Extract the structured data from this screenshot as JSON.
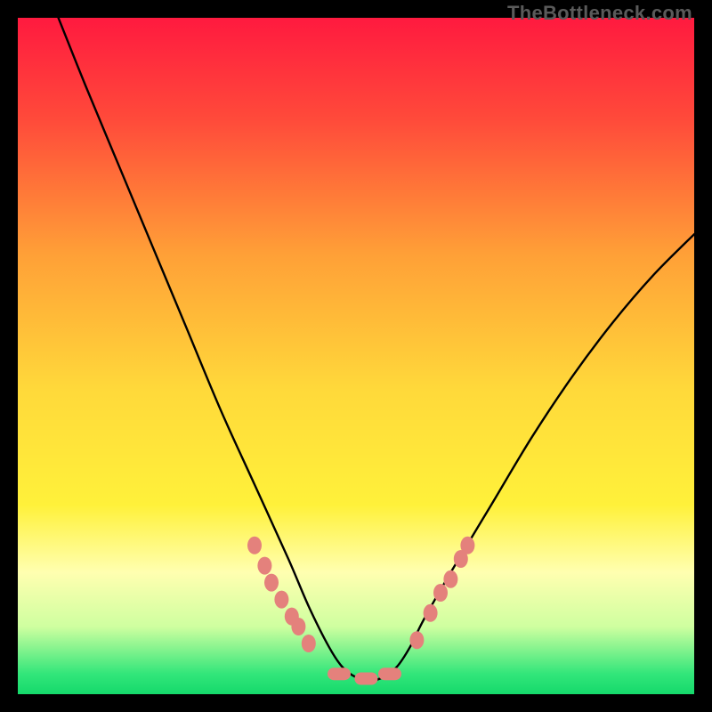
{
  "watermark": "TheBottleneck.com",
  "chart_data": {
    "type": "line",
    "title": "",
    "xlabel": "",
    "ylabel": "",
    "xlim": [
      0,
      100
    ],
    "ylim": [
      0,
      100
    ],
    "grid": false,
    "legend": false,
    "background_gradient_note": "vertical gradient from red (top) through orange, yellow, pale-yellow to green (bottom)",
    "gradient_stops": [
      {
        "pos": 0.0,
        "color": "#ff1a3f"
      },
      {
        "pos": 0.15,
        "color": "#ff4a3a"
      },
      {
        "pos": 0.35,
        "color": "#ffa037"
      },
      {
        "pos": 0.55,
        "color": "#ffd93a"
      },
      {
        "pos": 0.72,
        "color": "#fff13a"
      },
      {
        "pos": 0.82,
        "color": "#ffffb0"
      },
      {
        "pos": 0.9,
        "color": "#cfffa0"
      },
      {
        "pos": 0.97,
        "color": "#32e67a"
      },
      {
        "pos": 1.0,
        "color": "#15d96b"
      }
    ],
    "series": [
      {
        "name": "bottleneck-curve",
        "note": "y values are approximate percentage heights (0=bottom green, 100=top red). Curve is a V-shape with rounded bottom near x≈48-56.",
        "x": [
          6,
          10,
          15,
          20,
          25,
          30,
          35,
          40,
          43,
          46,
          48,
          50,
          52,
          54,
          56,
          58,
          60,
          64,
          70,
          76,
          82,
          88,
          94,
          100
        ],
        "y": [
          100,
          90,
          78,
          66,
          54,
          42,
          31,
          20,
          13,
          7,
          4,
          2.5,
          2,
          2.5,
          4,
          7,
          11,
          18,
          28,
          38,
          47,
          55,
          62,
          68
        ]
      }
    ],
    "markers": {
      "name": "highlight-dots",
      "color": "#e4817c",
      "note": "rounded pink markers clustered on both descending and ascending arms near the bottom, plus elongated markers at the trough",
      "points": [
        {
          "x": 35.0,
          "y": 22.0,
          "shape": "dot"
        },
        {
          "x": 36.5,
          "y": 19.0,
          "shape": "dot"
        },
        {
          "x": 37.5,
          "y": 16.5,
          "shape": "dot"
        },
        {
          "x": 39.0,
          "y": 14.0,
          "shape": "dot"
        },
        {
          "x": 40.5,
          "y": 11.5,
          "shape": "dot"
        },
        {
          "x": 41.5,
          "y": 10.0,
          "shape": "dot"
        },
        {
          "x": 43.0,
          "y": 7.5,
          "shape": "dot"
        },
        {
          "x": 47.5,
          "y": 3.0,
          "shape": "pill"
        },
        {
          "x": 51.5,
          "y": 2.3,
          "shape": "pill"
        },
        {
          "x": 55.0,
          "y": 3.0,
          "shape": "pill"
        },
        {
          "x": 59.0,
          "y": 8.0,
          "shape": "dot"
        },
        {
          "x": 61.0,
          "y": 12.0,
          "shape": "dot"
        },
        {
          "x": 62.5,
          "y": 15.0,
          "shape": "dot"
        },
        {
          "x": 64.0,
          "y": 17.0,
          "shape": "dot"
        },
        {
          "x": 65.5,
          "y": 20.0,
          "shape": "dot"
        },
        {
          "x": 66.5,
          "y": 22.0,
          "shape": "dot"
        }
      ]
    }
  }
}
